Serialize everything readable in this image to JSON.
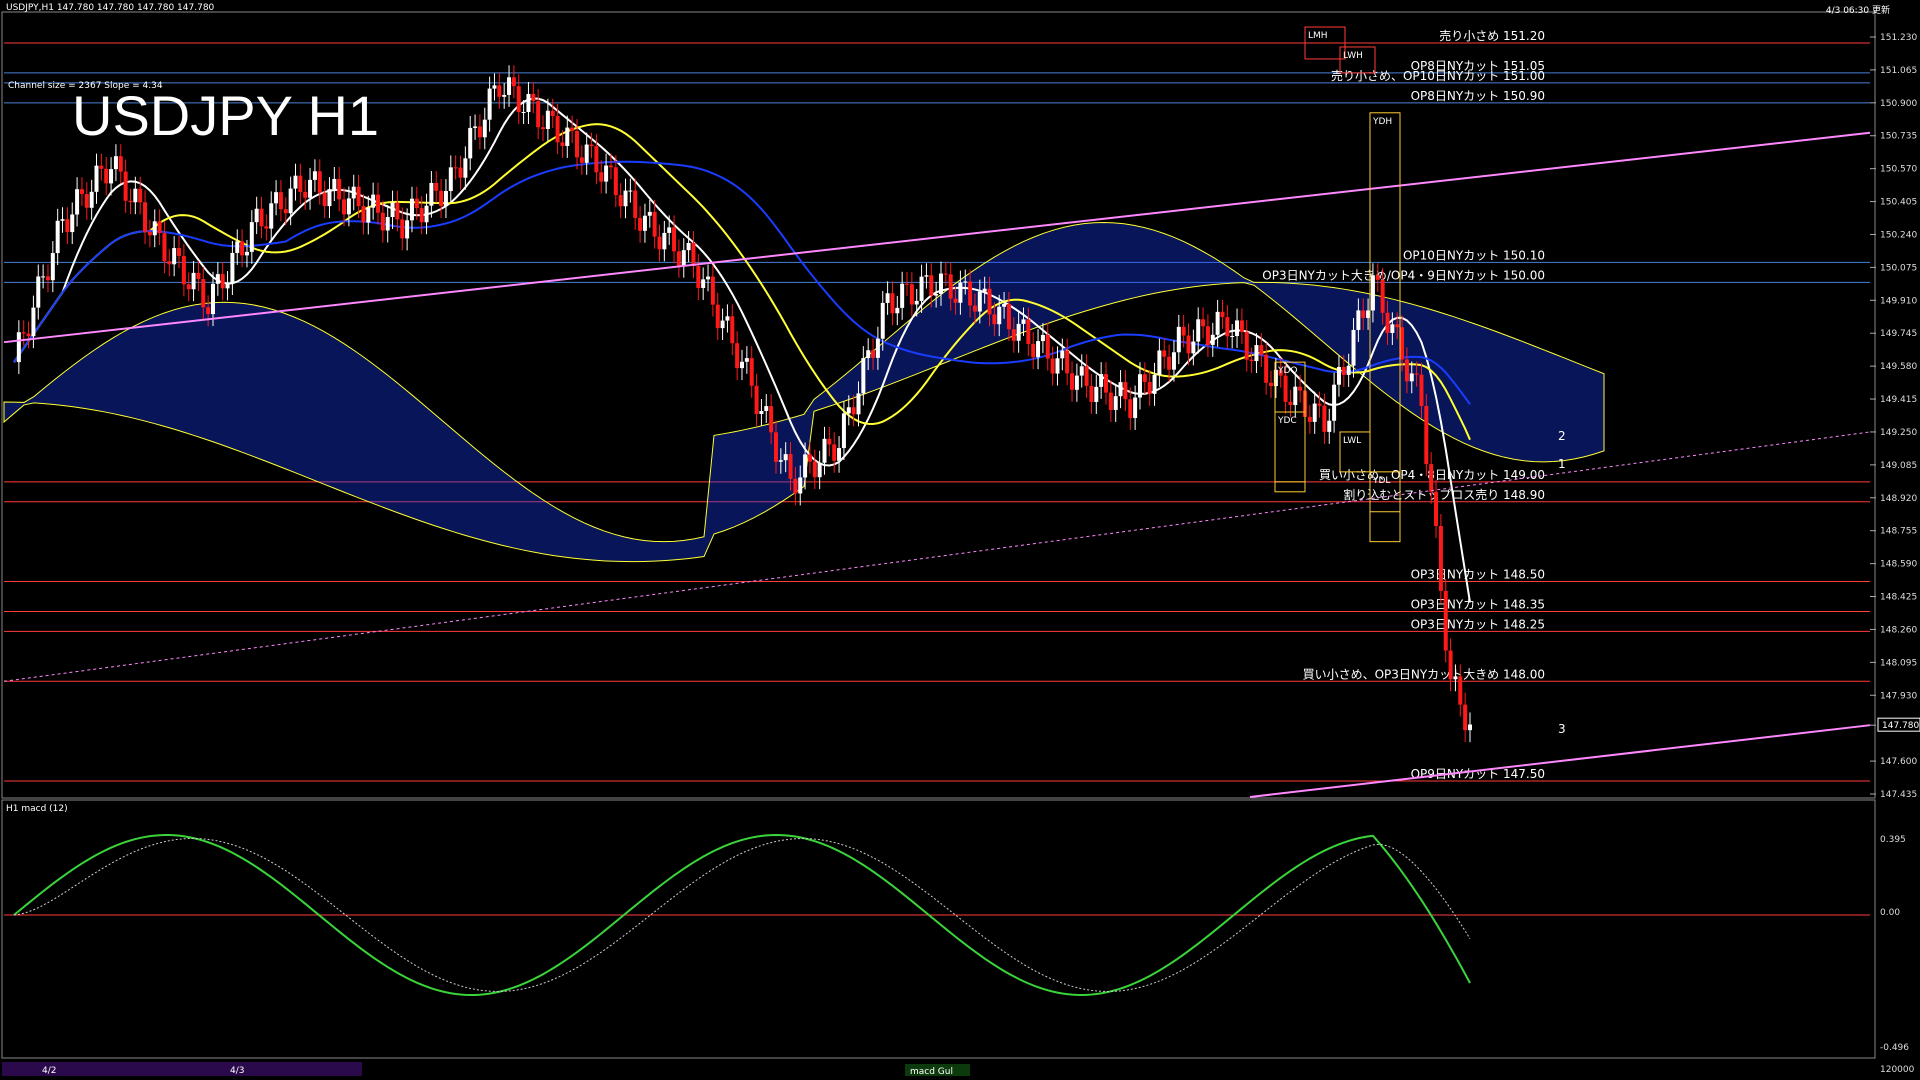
{
  "header": {
    "symbol_info": "USDJPY,H1  147.780 147.780 147.780 147.780",
    "updated": "4/3 06:30 更新",
    "big_title": "USDJPY H1",
    "channel_info": "Channel size = 2367 Slope = 4.34"
  },
  "macd_panel": {
    "title": "H1  macd (12)",
    "ticks": [
      "0.395",
      "0.00",
      "-0.496"
    ],
    "bottom_value": "120000",
    "tab_label": "macd Gul"
  },
  "date_bar": {
    "labels": [
      "4/2",
      "4/3"
    ]
  },
  "chart_data": {
    "type": "line",
    "title": "USDJPY H1",
    "ylim": [
      147.4,
      151.3
    ],
    "price_ticks": [
      "151.230",
      "151.065",
      "150.900",
      "150.735",
      "150.570",
      "150.405",
      "150.240",
      "150.075",
      "149.910",
      "149.745",
      "149.580",
      "149.415",
      "149.250",
      "149.085",
      "148.920",
      "148.755",
      "148.590",
      "148.425",
      "148.260",
      "148.095",
      "147.930",
      "147.780",
      "147.600",
      "147.435"
    ],
    "current_price": "147.780",
    "price_series": {
      "name": "USDJPY H1 close (approx.)",
      "x": [
        0,
        5,
        10,
        15,
        20,
        25,
        30,
        35,
        40,
        45,
        50,
        55,
        60,
        65,
        70,
        75,
        80,
        85,
        90,
        95,
        100,
        105,
        110,
        115,
        120,
        125,
        130,
        135,
        140,
        145,
        148,
        150
      ],
      "y": [
        149.6,
        150.3,
        150.6,
        150.2,
        149.9,
        150.3,
        150.5,
        150.4,
        150.3,
        150.5,
        151.0,
        150.8,
        150.6,
        150.3,
        150.1,
        149.6,
        149.0,
        149.2,
        149.9,
        150.0,
        149.9,
        149.7,
        149.5,
        149.4,
        149.7,
        149.8,
        149.5,
        149.3,
        150.0,
        149.4,
        148.0,
        147.78
      ]
    },
    "levels": [
      {
        "price": 151.2,
        "label": "売り小さめ 151.20",
        "color": "#ff3b3b"
      },
      {
        "price": 151.05,
        "label": "OP8日NYカット 151.05",
        "color": "#4a7fd6"
      },
      {
        "price": 151.0,
        "label": "売り小さめ、OP10日NYカット 151.00",
        "color": "#4a7fd6"
      },
      {
        "price": 150.9,
        "label": "OP8日NYカット 150.90",
        "color": "#4a7fd6"
      },
      {
        "price": 150.1,
        "label": "OP10日NYカット 150.10",
        "color": "#4a7fd6"
      },
      {
        "price": 150.0,
        "label": "OP3日NYカット大きめ/OP4・9日NYカット 150.00",
        "color": "#4a7fd6"
      },
      {
        "price": 149.0,
        "label": "買い小さめ、OP4・8日NYカット 149.00",
        "color": "#ff3b3b"
      },
      {
        "price": 148.9,
        "label": "割り込むとストップロス売り 148.90",
        "color": "#ff3b3b"
      },
      {
        "price": 148.5,
        "label": "OP3日NYカット 148.50",
        "color": "#ff3b3b"
      },
      {
        "price": 148.35,
        "label": "OP3日NYカット 148.35",
        "color": "#ff3b3b"
      },
      {
        "price": 148.25,
        "label": "OP3日NYカット 148.25",
        "color": "#ff3b3b"
      },
      {
        "price": 148.0,
        "label": "買い小さめ、OP3日NYカット大きめ 148.00",
        "color": "#ff3b3b"
      },
      {
        "price": 147.5,
        "label": "OP9日NYカット 147.50",
        "color": "#ff3b3b"
      }
    ],
    "box_labels": [
      "LMH",
      "LWH",
      "YDH",
      "YDO",
      "YDC",
      "LWL",
      "YDL"
    ],
    "projection_labels": [
      "2",
      "1",
      "3"
    ],
    "colors": {
      "up": "#ffffff",
      "down": "#ff1a1a",
      "ma_white": "#ffffff",
      "ma_yellow": "#ffff33",
      "ma_blue": "#1a3cff",
      "kumo": "#1a3cff",
      "trend": "#ff88ff",
      "green": "#22cc22"
    }
  }
}
